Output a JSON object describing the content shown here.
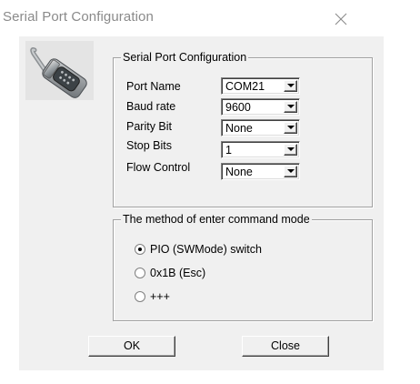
{
  "window": {
    "title": "Serial Port Configuration",
    "close_icon": "close-icon"
  },
  "app_icon": "serial-port-connector-icon",
  "settings_group": {
    "label": "Serial Port Configuration",
    "fields": [
      {
        "label": "Port Name",
        "value": "COM21"
      },
      {
        "label": "Baud rate",
        "value": "9600"
      },
      {
        "label": "Parity Bit",
        "value": "None"
      },
      {
        "label": "Stop Bits",
        "value": "1"
      },
      {
        "label": "Flow Control",
        "value": "None"
      }
    ]
  },
  "command_mode_group": {
    "label": "The method of enter command mode",
    "options": [
      {
        "label": "PIO (SWMode) switch",
        "selected": true
      },
      {
        "label": "0x1B (Esc)",
        "selected": false
      },
      {
        "label": "+++",
        "selected": false
      }
    ]
  },
  "buttons": {
    "ok": "OK",
    "close": "Close"
  },
  "colors": {
    "dialog_background": "#f0f0f0",
    "title_text": "#8a8a8a"
  }
}
